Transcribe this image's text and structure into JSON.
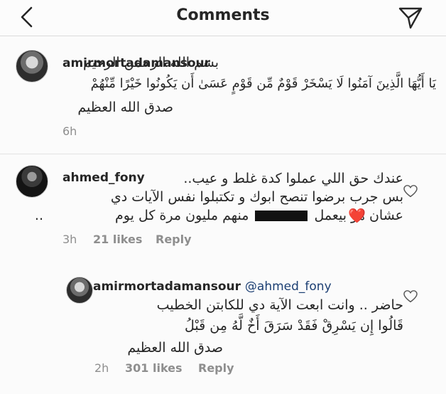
{
  "header": {
    "title": "Comments"
  },
  "caption": {
    "username": "amirmortadamansour",
    "line1": "بسم الله الرحمن الرحيم",
    "line2": "يَا أَيُّهَا الَّذِينَ آمَنُوا لَا يَسْخَرْ قَوْمٌ مِّن قَوْمٍ عَسَىٰ أَن يَكُونُوا خَيْرًا مِّنْهُمْ",
    "line3": "صدق الله العظيم",
    "time": "6h"
  },
  "comment1": {
    "username": "ahmed_fony",
    "line1": "عندك حق اللي عملوا كدة غلط و عيب..",
    "line2": "بس جرب برضوا تنصح ابوك و تكتبلوا نفس الآيات دي",
    "line3_part1": "عشان هو بيعمل",
    "line3_part2": "منهم مليون مرة كل يوم",
    "line3_dots": "..",
    "heart_emoji": "❤️",
    "time": "3h",
    "likes": "21 likes",
    "reply": "Reply"
  },
  "reply1": {
    "username": "amirmortadamansour",
    "mention": "@ahmed_fony",
    "line1": "حاضر .. وانت ابعت الآية دي للكابتن الخطيب",
    "line2": "قَالُوا إِن يَسْرِقْ فَقَدْ سَرَقَ أَخٌ لَّهُ مِن قَبْلُ",
    "line3": "صدق الله العظيم",
    "time": "2h",
    "likes": "301 likes",
    "reply": "Reply"
  },
  "icons": {
    "back": "chevron-left-icon",
    "share": "paper-plane-icon",
    "like": "heart-outline-icon"
  }
}
